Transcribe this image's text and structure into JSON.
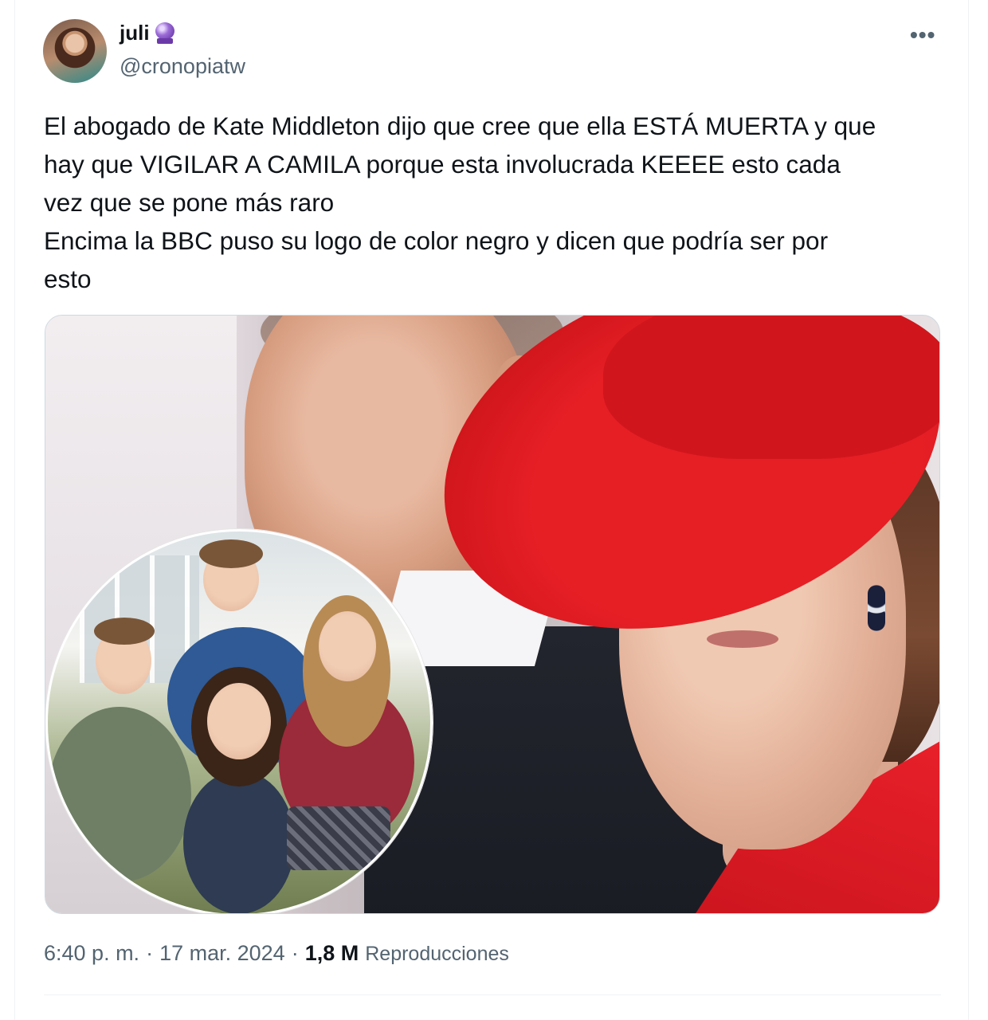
{
  "author": {
    "display_name": "juli",
    "handle": "@cronopiatw",
    "name_emoji_icon": "crystal-ball-icon"
  },
  "menu_icon": "more-horizontal-icon",
  "tweet": {
    "lines": [
      "El abogado de Kate Middleton dijo que cree que ella ESTÁ MUERTA y que",
      "hay que VIGILAR A CAMILA porque esta involucrada KEEEE esto cada",
      "vez que se pone más raro",
      "Encima la BBC puso su logo de color negro y dicen que podría ser por",
      "esto"
    ]
  },
  "meta": {
    "time": "6:40 p. m.",
    "separator": "·",
    "date": "17 mar. 2024",
    "views_count": "1,8 M",
    "views_label": "Reproducciones"
  },
  "colors": {
    "text": "#0f1419",
    "secondary": "#536471",
    "hat_red": "#d0161c"
  }
}
